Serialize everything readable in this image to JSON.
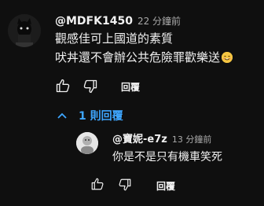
{
  "comment": {
    "author": "@MDFK1450",
    "time": "22 分鐘前",
    "line1": "觀感佳可上國道的素質",
    "line2": "吠丼還不會辦公共危險罪歡樂送",
    "emoji": "smiling-face-emoji",
    "reply_label": "回覆"
  },
  "replies_toggle": {
    "label": "1 則回覆",
    "color": "#3ea6ff"
  },
  "reply": {
    "author": "@寶妮-e7z",
    "time": "13 分鐘前",
    "text": "你是不是只有機車笑死",
    "reply_label": "回覆"
  }
}
